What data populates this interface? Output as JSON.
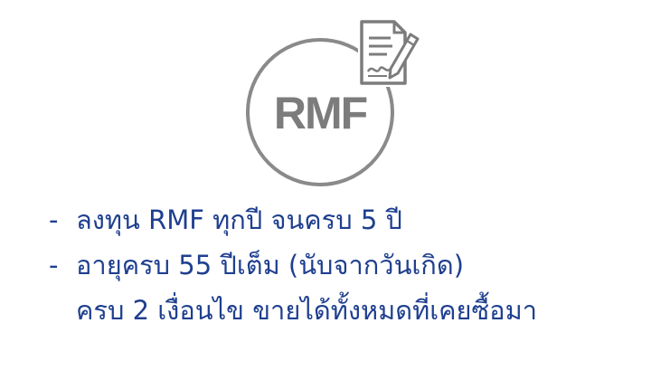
{
  "logo": {
    "text": "RMF",
    "icon": "signed-contract-icon",
    "color": "#7c7c7c"
  },
  "conditions": {
    "bullet": "-",
    "items": [
      {
        "text": "ลงทุน RMF ทุกปี จนครบ 5 ปี"
      },
      {
        "text": "อายุครบ 55 ปีเต็ม (นับจากวันเกิด)"
      }
    ],
    "continuation": "ครบ 2 เงื่อนไข ขายได้ทั้งหมดที่เคยซื้อมา",
    "color": "#1f3f8f"
  }
}
